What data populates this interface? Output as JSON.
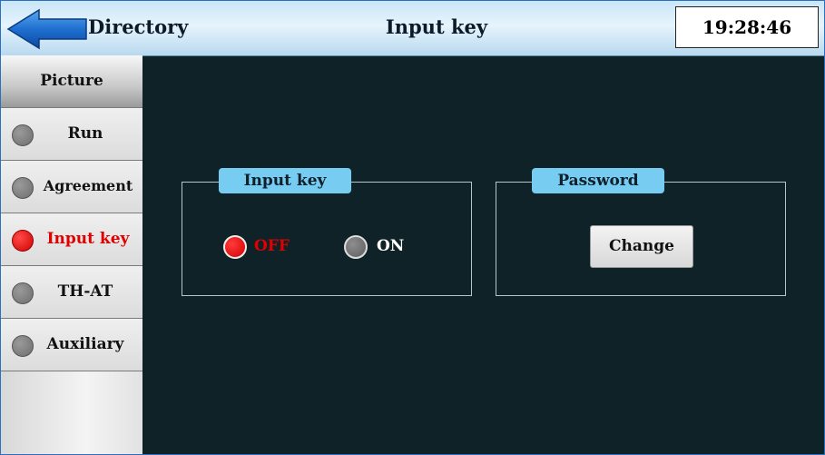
{
  "header": {
    "directory_label": "Directory",
    "title": "Input key",
    "clock": "19:28:46",
    "back_icon": "back-arrow-icon"
  },
  "sidebar": {
    "header_label": "Picture",
    "items": [
      {
        "label": "Run",
        "active": false
      },
      {
        "label": "Agreement",
        "active": false
      },
      {
        "label": "Input key",
        "active": true
      },
      {
        "label": "TH-AT",
        "active": false
      },
      {
        "label": "Auxiliary",
        "active": false
      }
    ]
  },
  "input_key_panel": {
    "title": "Input key",
    "options": [
      {
        "label": "OFF",
        "selected": true
      },
      {
        "label": "ON",
        "selected": false
      }
    ]
  },
  "password_panel": {
    "title": "Password",
    "change_label": "Change"
  },
  "colors": {
    "background": "#0f2228",
    "active_red": "#e00000",
    "tab_blue": "#77ccf2"
  }
}
